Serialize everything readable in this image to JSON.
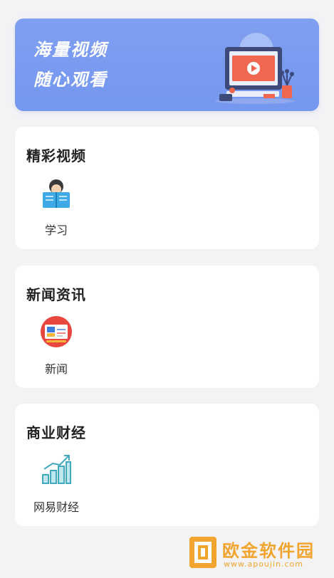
{
  "banner": {
    "line1": "海量视频",
    "line2": "随心观看"
  },
  "sections": [
    {
      "title": "精彩视频",
      "items": [
        {
          "label": "学习",
          "icon": "reading-student-icon"
        }
      ]
    },
    {
      "title": "新闻资讯",
      "items": [
        {
          "label": "新闻",
          "icon": "news-board-icon"
        }
      ]
    },
    {
      "title": "商业财经",
      "items": [
        {
          "label": "网易财经",
          "icon": "bar-chart-growth-icon"
        }
      ]
    }
  ],
  "watermark": {
    "title": "欧金软件园",
    "url": "www.apoujin.com"
  },
  "colors": {
    "banner": "#7b9bf0",
    "card": "#ffffff",
    "background": "#f3f3f6",
    "watermark": "#f2a52e"
  }
}
